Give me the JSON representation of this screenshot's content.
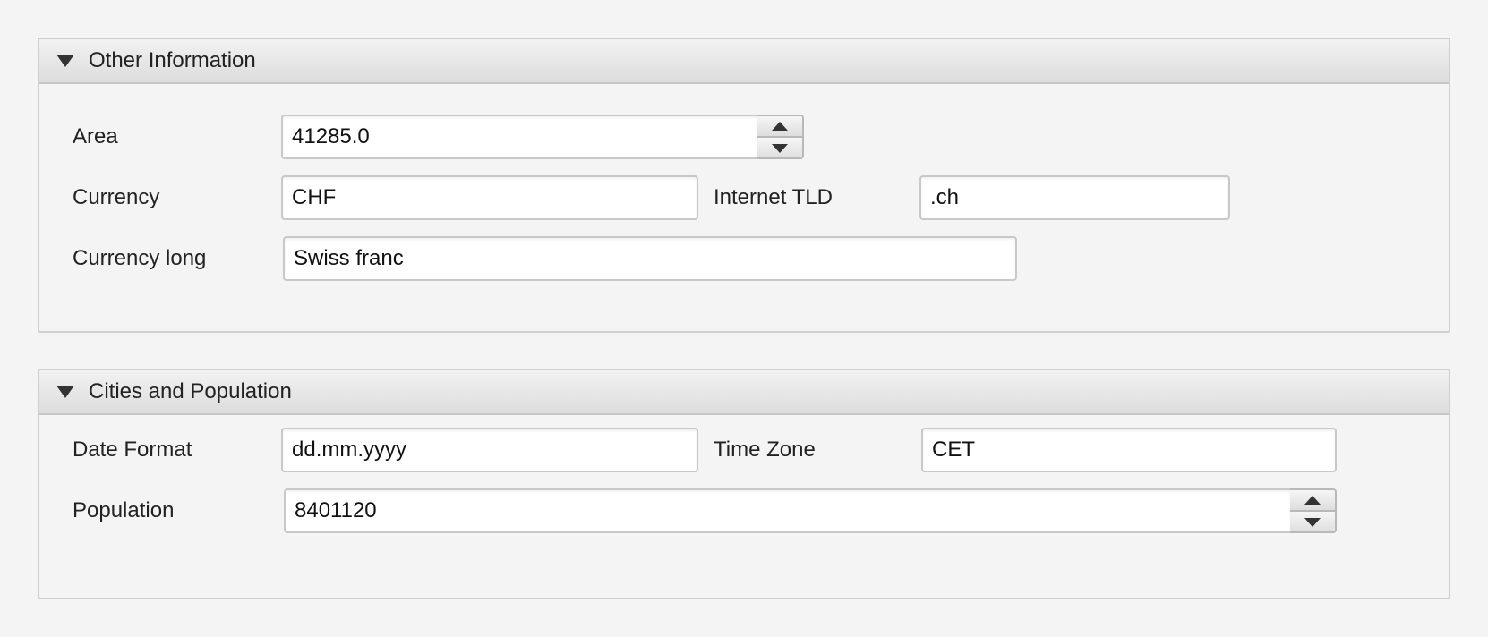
{
  "other_info": {
    "title": "Other Information",
    "area_label": "Area",
    "area_value": "41285.0",
    "currency_label": "Currency",
    "currency_value": "CHF",
    "tld_label": "Internet TLD",
    "tld_value": ".ch",
    "currency_long_label": "Currency long",
    "currency_long_value": "Swiss franc"
  },
  "cities": {
    "title": "Cities and Population",
    "date_format_label": "Date Format",
    "date_format_value": "dd.mm.yyyy",
    "time_zone_label": "Time Zone",
    "time_zone_value": "CET",
    "population_label": "Population",
    "population_value": "8401120"
  },
  "icons": {
    "collapse": "triangle-down-icon",
    "spin_up": "arrow-up-icon",
    "spin_down": "arrow-down-icon"
  }
}
